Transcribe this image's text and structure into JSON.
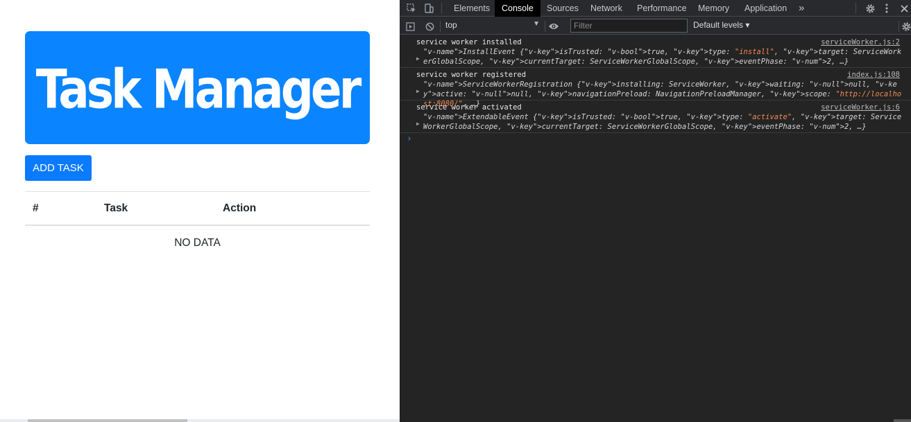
{
  "app": {
    "title": "Task Manager",
    "add_button": "ADD TASK",
    "table": {
      "headers": [
        "#",
        "Task",
        "Action"
      ],
      "empty_text": "NO DATA"
    }
  },
  "devtools": {
    "tabs": [
      "Elements",
      "Console",
      "Sources",
      "Network",
      "Performance",
      "Memory",
      "Application"
    ],
    "active_tab": "Console",
    "more_tabs": "»",
    "context": "top",
    "filter_placeholder": "Filter",
    "levels": "Default levels ▾",
    "messages": [
      {
        "text": "service worker installed",
        "source": "serviceWorker.js:2",
        "object": "InstallEvent {isTrusted: true, type: \"install\", target: ServiceWorkerGlobalScope, currentTarget: ServiceWorkerGlobalScope, eventPhase: 2, …}"
      },
      {
        "text": "service worker registered",
        "source": "index.js:108",
        "object": "ServiceWorkerRegistration {installing: ServiceWorker, waiting: null, active: null, navigationPreload: NavigationPreloadManager, scope: \"http://localhost:8080/\", …}"
      },
      {
        "text": "service worker activated",
        "source": "serviceWorker.js:6",
        "object": "ExtendableEvent {isTrusted: true, type: \"activate\", target: ServiceWorkerGlobalScope, currentTarget: ServiceWorkerGlobalScope, eventPhase: 2, …}"
      }
    ],
    "prompt": "›"
  },
  "colors": {
    "brand": "#0a84ff",
    "devtools_bg": "#242424"
  }
}
